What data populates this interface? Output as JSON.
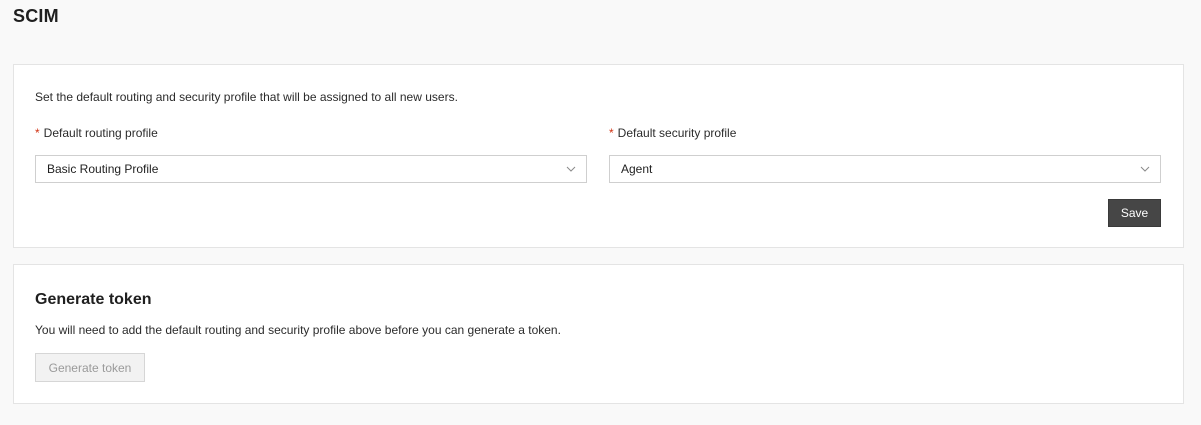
{
  "page": {
    "title": "SCIM"
  },
  "profiles": {
    "description": "Set the default routing and security profile that will be assigned to all new users.",
    "required_marker": "*",
    "routing": {
      "label": "Default routing profile",
      "value": "Basic Routing Profile"
    },
    "security": {
      "label": "Default security profile",
      "value": "Agent"
    },
    "save_label": "Save"
  },
  "token": {
    "title": "Generate token",
    "description": "You will need to add the default routing and security profile above before you can generate a token.",
    "button_label": "Generate token",
    "button_disabled": true
  },
  "icons": {
    "select_chevron": "chevron-down-icon"
  },
  "colors": {
    "required": "#d13212",
    "primary_button": "#464646",
    "background": "#f9f9f9"
  }
}
